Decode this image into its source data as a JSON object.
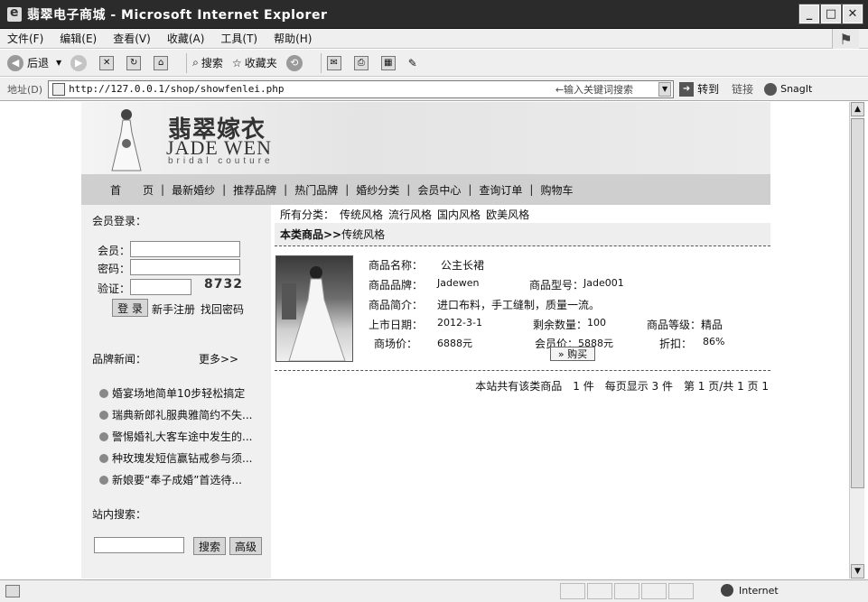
{
  "window": {
    "title": "翡翠电子商城 - Microsoft Internet Explorer",
    "buttons": {
      "minimize": "_",
      "maximize": "□",
      "close": "✕"
    }
  },
  "menu": [
    "文件(F)",
    "编辑(E)",
    "查看(V)",
    "收藏(A)",
    "工具(T)",
    "帮助(H)"
  ],
  "toolbar": {
    "back": "后退",
    "search": "搜索",
    "favorites": "收藏夹"
  },
  "address": {
    "label": "地址(D)",
    "url": "http://127.0.0.1/shop/showfenlei.php",
    "hint": "←输入关键词搜索",
    "go": "转到",
    "links": "链接",
    "snagit": "SnagIt"
  },
  "banner": {
    "logo_cn": "翡翠嫁衣",
    "logo_en": "JADE WEN",
    "logo_sub": "bridal couture"
  },
  "nav": [
    "首　　页",
    "最新婚纱",
    "推荐品牌",
    "热门品牌",
    "婚纱分类",
    "会员中心",
    "查询订单",
    "购物车"
  ],
  "login": {
    "heading": "会员登录：",
    "member_label": "会员：",
    "password_label": "密码：",
    "captcha_label": "验证：",
    "captcha_code": "8732",
    "login_button": "登 录",
    "register_link": "新手注册",
    "recover_link": "找回密码"
  },
  "brand_news": {
    "heading": "品牌新闻：",
    "more": "更多>>",
    "items": [
      "婚宴场地简单10步轻松搞定",
      "瑞典新郎礼服典雅简约不失...",
      "警惕婚礼大客车途中发生的...",
      "种玫瑰发短信赢钻戒参与须...",
      "新娘要“奉子成婚”首选待..."
    ]
  },
  "site_search": {
    "heading": "站内搜索：",
    "search_button": "搜索",
    "advanced_button": "高级"
  },
  "categories": {
    "label": "所有分类：",
    "items": [
      "传统风格",
      "流行风格",
      "国内风格",
      "欧美风格"
    ]
  },
  "breadcrumb": {
    "prefix": "本类商品>>",
    "current": "传统风格"
  },
  "product": {
    "name_label": "商品名称：",
    "name": "公主长裙",
    "brand_label": "商品品牌：",
    "brand": "Jadewen",
    "model_label": "商品型号：",
    "model": "Jade001",
    "intro_label": "商品简介：",
    "intro": "进口布料，手工缝制，质量一流。",
    "date_label": "上市日期：",
    "date": "2012-3-1",
    "stock_label": "剩余数量：",
    "stock": "100",
    "grade_label": "商品等级：",
    "grade": "精品",
    "market_label": "商场价：",
    "market_price": "6888元",
    "member_label": "会员价：",
    "member_price": "5888元",
    "discount_label": "折扣：",
    "discount": "86%",
    "buy_button": "» 购买"
  },
  "pager": {
    "text": "本站共有该类商品　1 件　每页显示 3 件　第 1 页/共 1 页 1"
  },
  "status": {
    "zone": "Internet"
  }
}
